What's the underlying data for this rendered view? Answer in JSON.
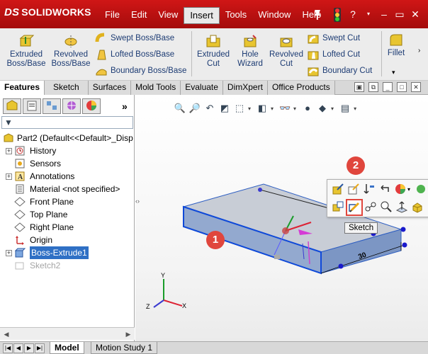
{
  "app": {
    "logo_ds": "DS",
    "logo_text": "SOLIDWORKS",
    "brand_red": "#c41111"
  },
  "menu": {
    "items": [
      "File",
      "Edit",
      "View",
      "Insert",
      "Tools",
      "Window",
      "Help"
    ],
    "active": "Insert"
  },
  "title_icons": [
    "pushpin-icon",
    "traffic-light-icon",
    "help-icon",
    "minimize-icon",
    "maximize-icon",
    "close-icon"
  ],
  "ribbon": {
    "extruded_boss": "Extruded\nBoss/Base",
    "revolved_boss": "Revolved\nBoss/Base",
    "swept_boss": "Swept Boss/Base",
    "lofted_boss": "Lofted Boss/Base",
    "boundary_boss": "Boundary Boss/Base",
    "extruded_cut": "Extruded\nCut",
    "hole_wizard": "Hole\nWizard",
    "revolved_cut": "Revolved\nCut",
    "swept_cut": "Swept Cut",
    "lofted_cut": "Lofted Cut",
    "boundary_cut": "Boundary Cut",
    "fillet": "Fillet"
  },
  "tabs": [
    "Features",
    "Sketch",
    "Surfaces",
    "Mold Tools",
    "Evaluate",
    "DimXpert",
    "Office Products"
  ],
  "active_tab": "Features",
  "panel": {
    "more": "»",
    "tree": [
      {
        "label": "Part2  (Default<<Default>_Disp",
        "icon": "part-icon",
        "root": true
      },
      {
        "label": "History",
        "icon": "history-icon",
        "expand": "+"
      },
      {
        "label": "Sensors",
        "icon": "sensor-icon"
      },
      {
        "label": "Annotations",
        "icon": "annotations-icon",
        "expand": "+"
      },
      {
        "label": "Material <not specified>",
        "icon": "material-icon"
      },
      {
        "label": "Front Plane",
        "icon": "plane-icon"
      },
      {
        "label": "Top Plane",
        "icon": "plane-icon"
      },
      {
        "label": "Right Plane",
        "icon": "plane-icon"
      },
      {
        "label": "Origin",
        "icon": "origin-icon"
      },
      {
        "label": "Boss-Extrude1",
        "icon": "extrude-icon",
        "expand": "+",
        "selected": true
      },
      {
        "label": "Sketch2",
        "icon": "sketch-icon",
        "dim": true
      }
    ]
  },
  "bottom_tabs": [
    "Model",
    "Motion Study 1"
  ],
  "active_bottom_tab": "Model",
  "context": {
    "tooltip": "Sketch",
    "badge1": "1",
    "badge2": "2"
  },
  "model": {
    "dimension": "30",
    "axes": {
      "x": "X",
      "y": "Y",
      "z": "Z"
    }
  }
}
